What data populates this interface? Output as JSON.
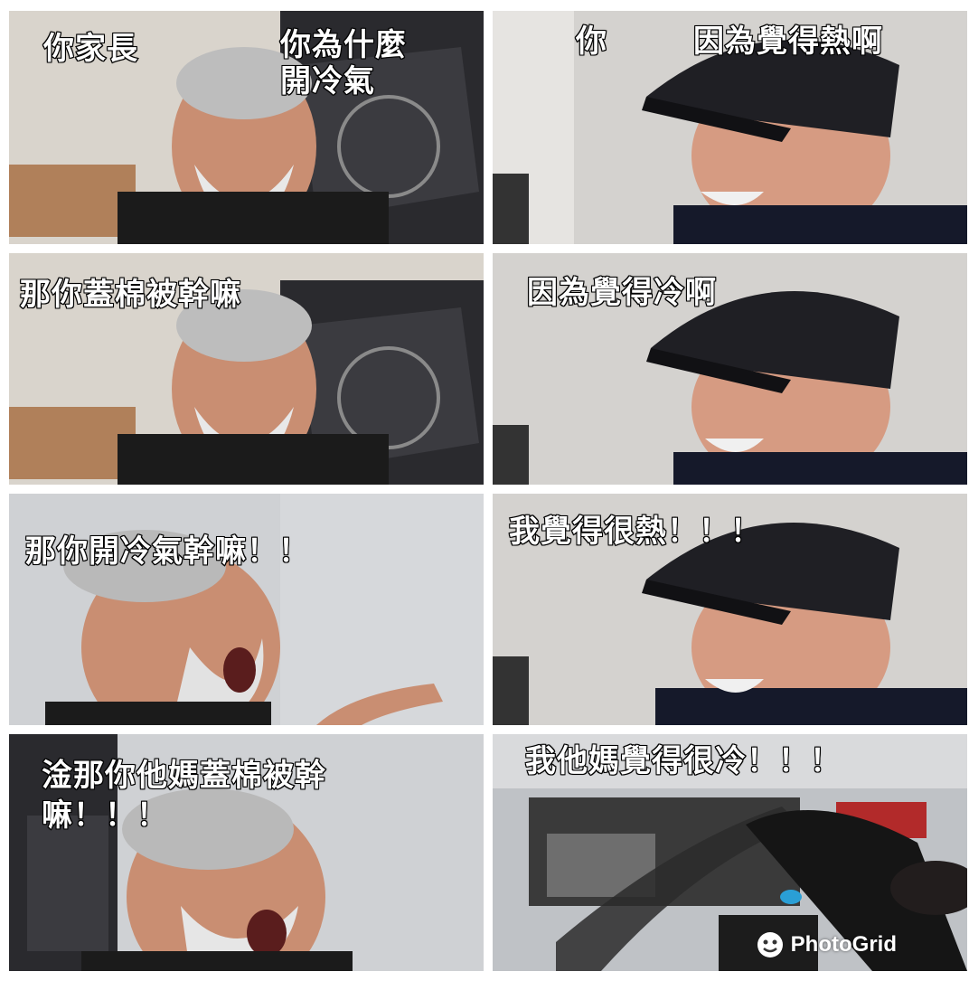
{
  "panels": [
    {
      "id": "p1",
      "speaker": "old-man",
      "captions": [
        "你家長",
        "你為什麼\n開冷氣"
      ]
    },
    {
      "id": "p2",
      "speaker": "young-man",
      "captions": [
        "你",
        "因為覺得熱啊"
      ]
    },
    {
      "id": "p3",
      "speaker": "old-man",
      "captions": [
        "那你蓋棉被幹嘛"
      ]
    },
    {
      "id": "p4",
      "speaker": "young-man",
      "captions": [
        "因為覺得冷啊"
      ]
    },
    {
      "id": "p5",
      "speaker": "old-man",
      "captions": [
        "那你開冷氣幹嘛！！"
      ]
    },
    {
      "id": "p6",
      "speaker": "young-man",
      "captions": [
        "我覺得很熱！！！"
      ]
    },
    {
      "id": "p7",
      "speaker": "old-man",
      "captions": [
        "淦那你他媽蓋棉被幹\n嘛！！！"
      ]
    },
    {
      "id": "p8",
      "speaker": "young-man",
      "captions": [
        "我他媽覺得很冷！！！"
      ]
    }
  ],
  "watermark": {
    "text": "PhotoGrid",
    "icon": "photogrid-logo-icon"
  },
  "colors": {
    "caption_fill": "#ffffff",
    "caption_stroke": "#000000",
    "background": "#ffffff"
  }
}
